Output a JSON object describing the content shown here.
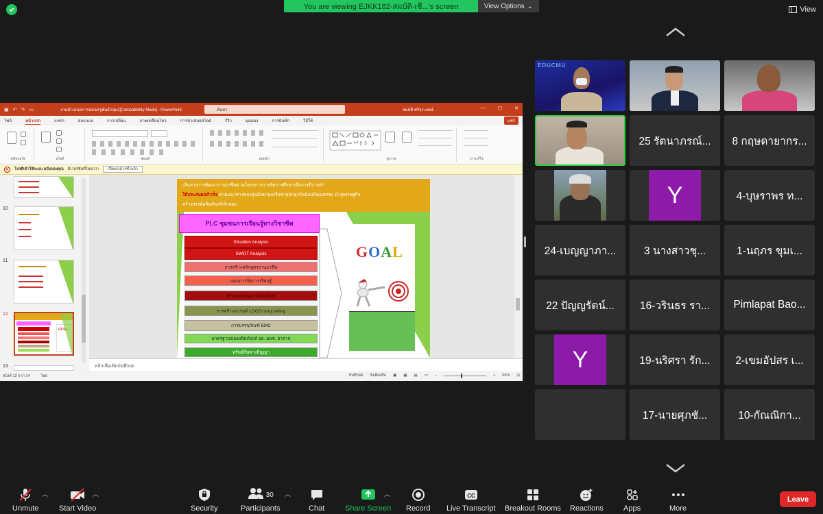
{
  "top_bar": {
    "banner": "You are viewing EJKK182-สมบัติ-เชี...'s screen",
    "view_options": "View Options",
    "view": "View"
  },
  "powerpoint": {
    "filename": "งานนำเสนอการสอนครูพันธ์กลุ่ม2[Compatibility Mode] - PowerPoint",
    "search_placeholder": "ค้นหา",
    "user": "สมบัติ ศรีจระพงษ์",
    "tabs": [
      "ไฟล์",
      "หน้าแรก",
      "แทรก",
      "ออกแบบ",
      "การเปลี่ยน",
      "ภาพเคลื่อนไหว",
      "การนำเสนอสไลด์",
      "รีวิว",
      "มุมมอง",
      "การบันทึก",
      "วิธีใช้"
    ],
    "share": "แชร์",
    "ribbon_groups": [
      "คลิปบอร์ด",
      "สไลด์",
      "ฟอนต์",
      "ย่อหน้า",
      "รูปวาด",
      "การแก้ไข"
    ],
    "message_bar": {
      "title": "โปรดีเข้าใช้ระบบ ฉบับของคุณ",
      "text": "มีเวอร์ชันที่ใหม่กว่า",
      "button": "เปิดเอกสารซ้ำแล้ว"
    },
    "thumb_numbers": [
      "10",
      "11",
      "12",
      "13"
    ],
    "notes_placeholder": "คลิกเพื่อเพิ่มบันทึกย่อ",
    "status": {
      "slide_info": "สไลด์ 12 จาก 14",
      "language": "ไทย",
      "notes": "บันทึกย่อ",
      "comments": "ข้อคิดเห็น",
      "zoom": "69%"
    },
    "slide": {
      "header_line1": "เส้นทางการพัฒนางานอาชีพตามโครงการการจัดการศึกษาเพื่อการมีงานทำ",
      "header_red": "ให้ประสบผลสำเร็จ",
      "header_line2": "ตามแนวทางของศูนย์ขยายเครือข่ายนักธุรกิจน้อยมีคุณธรรม นำสู่เศรษฐกิจ",
      "header_line3": "สร้างสรรค์ผลิตภัณฑ์เล็กตอบ",
      "plc_title": "PLC ชุมชนการเรียนรู้ทางวิชาชีพ",
      "bars": [
        "Situation Analysis",
        "SWOT Analysis",
        "การสร้างหลักสูตรงานอาชีพ",
        "แผนการจัดการเรียนรู้",
        "สร้างและพัฒนาผลิตภัณฑ์",
        "การสร้างแบรนด์    LOGO   story telling",
        "การบรรจุภัณฑ์ BMC",
        "มาตรฐานของผลิตภัณฑ์  อย.  มผช. ฮาลาล",
        "ทรัพย์สินทางปัญญา"
      ],
      "goal": "GOAL"
    }
  },
  "participants": {
    "tiles": [
      "25 รัตนาภรณ์...",
      "8 กฤษดายากร...",
      "4-บุษราพร ท...",
      "24-เบญญาภา...",
      "3 นางสาวชุ...",
      "1-นฤภร ขุมเ...",
      "22 ปัญญรัตน์...",
      "16-วรินธร รา...",
      "Pimlapat Bao...",
      "19-นริศรา รัก...",
      "2-เขมอัปสร เ...",
      "17-นายศุภชั...",
      "10-กัณณิกา..."
    ],
    "avatar_letter": "Y",
    "edu_logo": "EDUCMU"
  },
  "toolbar": {
    "unmute": "Unmute",
    "start_video": "Start Video",
    "security": "Security",
    "participants": "Participants",
    "participants_count": "30",
    "chat": "Chat",
    "share_screen": "Share Screen",
    "record": "Record",
    "live_transcript": "Live Transcript",
    "breakout_rooms": "Breakout Rooms",
    "reactions": "Reactions",
    "apps": "Apps",
    "more": "More",
    "leave": "Leave"
  },
  "colors": {
    "ppt_accent": "#c43e1c",
    "zoom_green": "#22c55e",
    "leave_red": "#e02828",
    "avatar_purple": "#8e1aa9"
  }
}
